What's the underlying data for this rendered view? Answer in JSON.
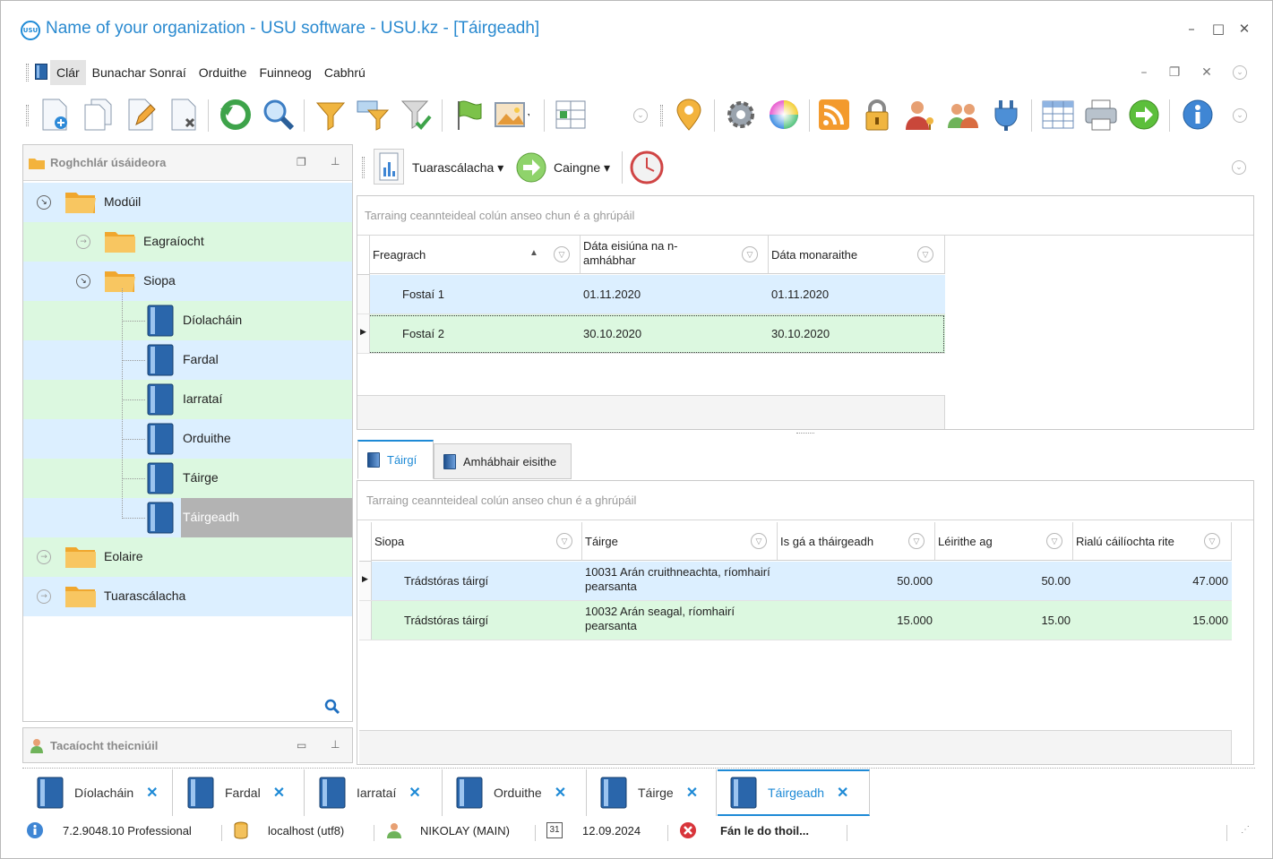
{
  "window": {
    "title": "Name of your organization - USU software - USU.kz - [Táirgeadh]",
    "logo_text": "USU"
  },
  "menu": [
    "Clár",
    "Bunachar Sonraí",
    "Orduithe",
    "Fuinneog",
    "Cabhrú"
  ],
  "left_panel": {
    "title": "Roghchlár úsáideora",
    "tree": [
      {
        "label": "Modúil"
      },
      {
        "label": "Eagraíocht"
      },
      {
        "label": "Siopa"
      },
      {
        "label": "Díolacháin"
      },
      {
        "label": "Fardal"
      },
      {
        "label": "Iarrataí"
      },
      {
        "label": "Orduithe"
      },
      {
        "label": "Táirge"
      },
      {
        "label": "Táirgeadh"
      },
      {
        "label": "Eolaire"
      },
      {
        "label": "Tuarascálacha"
      }
    ],
    "bottom_title": "Tacaíocht theicniúil"
  },
  "right_toolbar": {
    "reports_label": "Tuarascálacha",
    "actions_label": "Caingne"
  },
  "grid1": {
    "group_hint": "Tarraing ceannteideal colún anseo chun é a ghrúpáil",
    "columns": [
      "Freagrach",
      "Dáta eisiúna na n-amhábhar",
      "Dáta monaraithe"
    ],
    "rows": [
      [
        "Fostaí 1",
        "01.11.2020",
        "01.11.2020"
      ],
      [
        "Fostaí 2",
        "30.10.2020",
        "30.10.2020"
      ]
    ]
  },
  "tabs": [
    "Táirgí",
    "Amhábhair eisithe"
  ],
  "grid2": {
    "group_hint": "Tarraing ceannteideal colún anseo chun é a ghrúpáil",
    "columns": [
      "Siopa",
      "Táirge",
      "Is gá a tháirgeadh",
      "Léirithe ag",
      "Rialú cáilíochta rite"
    ],
    "rows": [
      [
        "Trádstóras táirgí",
        "10031 Arán cruithneachta, ríomhairí pearsanta",
        "50.000",
        "50.00",
        "47.000"
      ],
      [
        "Trádstóras táirgí",
        "10032 Arán seagal, ríomhairí pearsanta",
        "15.000",
        "15.00",
        "15.000"
      ]
    ]
  },
  "doc_tabs": [
    "Díolacháin",
    "Fardal",
    "Iarrataí",
    "Orduithe",
    "Táirge",
    "Táirgeadh"
  ],
  "status": {
    "version": "7.2.9048.10 Professional",
    "db": "localhost (utf8)",
    "user": "NIKOLAY (MAIN)",
    "calendar_day": "31",
    "date": "12.09.2024",
    "message": "Fán le do thoil..."
  },
  "colors": {
    "accent": "#1e8ad6",
    "row_blue": "#dcefff",
    "row_green": "#dcf8e0",
    "selected": "#b3b3b3"
  }
}
